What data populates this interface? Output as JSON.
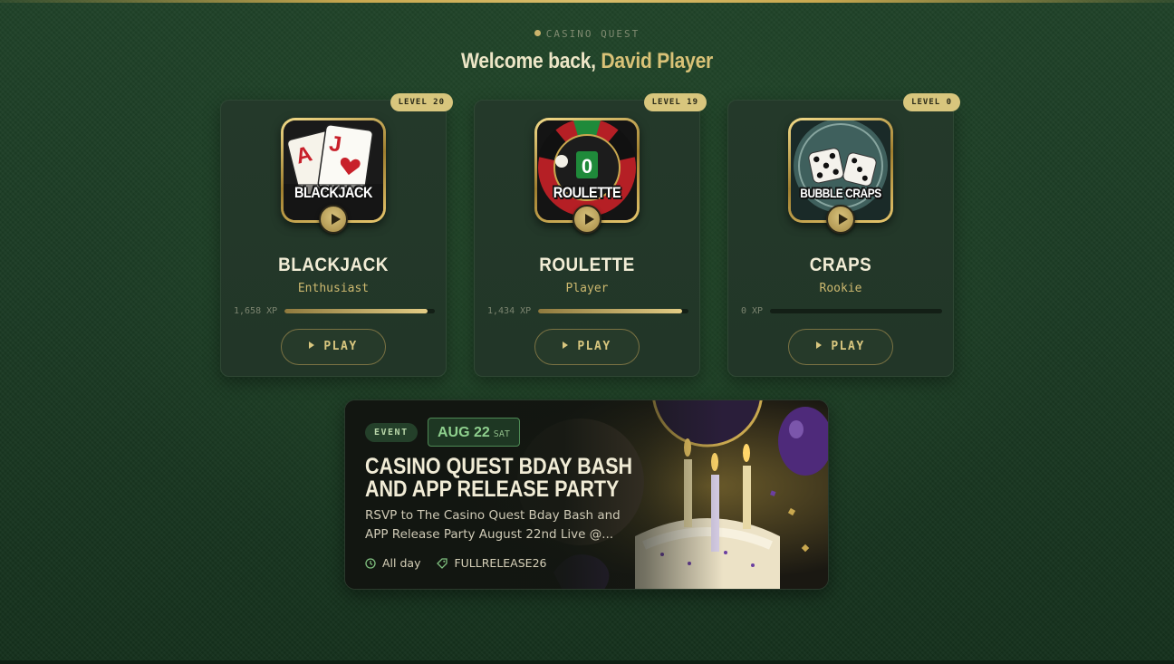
{
  "brand": {
    "eyebrow": "CASINO QUEST"
  },
  "welcome": {
    "prefix": "Welcome back,",
    "name": "David Player"
  },
  "games": [
    {
      "title": "BLACKJACK",
      "icon_label": "BLACKJACK",
      "icon": "blackjack-cards-icon",
      "level": "LEVEL 20",
      "rank": "Enthusiast",
      "xp": "1,658 XP",
      "progress": 0.95,
      "play_label": "PLAY"
    },
    {
      "title": "ROULETTE",
      "icon_label": "ROULETTE",
      "icon": "roulette-wheel-icon",
      "level": "LEVEL 19",
      "rank": "Player",
      "xp": "1,434 XP",
      "progress": 0.96,
      "play_label": "PLAY"
    },
    {
      "title": "CRAPS",
      "icon_label": "BUBBLE CRAPS",
      "icon": "dice-icon",
      "level": "LEVEL 0",
      "rank": "Rookie",
      "xp": "0 XP",
      "progress": 0.0,
      "play_label": "PLAY"
    }
  ],
  "event": {
    "tag": "EVENT",
    "date": "AUG 22",
    "weekday": "SAT",
    "title": "Casino Quest Bday Bash and App Release Party",
    "description": "RSVP to The Casino Quest Bday Bash and APP Release Party August 22nd Live @...",
    "time": "All day",
    "code": "FULLRELEASE26"
  },
  "colors": {
    "background": "#1b3a24",
    "card": "#24392a",
    "gold_accent": "#d9c277",
    "badge": "#d8c67d",
    "event_green": "#8fd08e"
  }
}
